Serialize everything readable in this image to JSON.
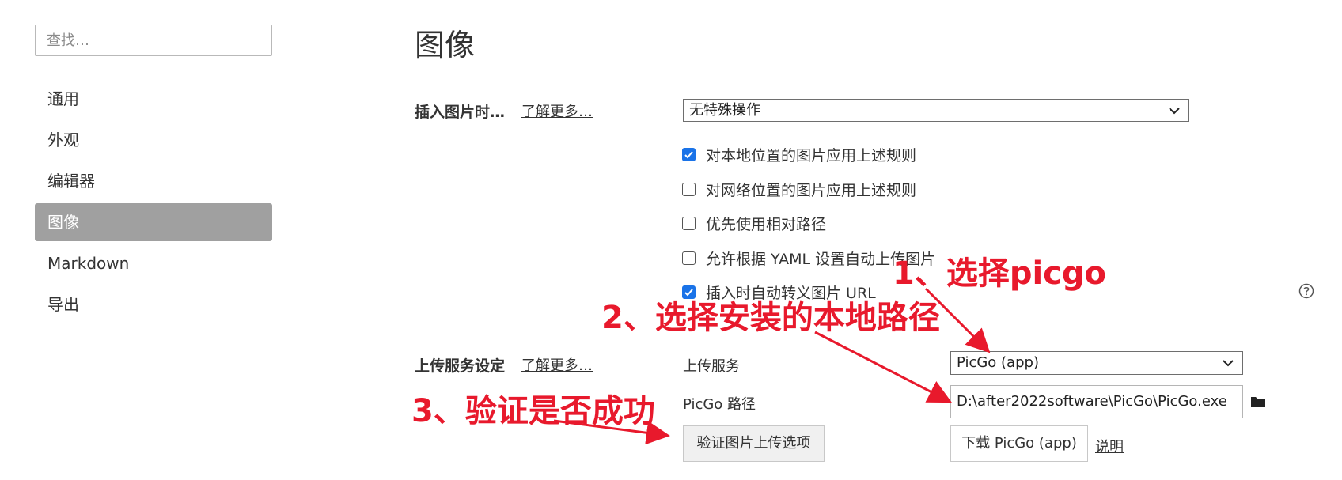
{
  "sidebar": {
    "search_placeholder": "查找…",
    "items": [
      {
        "label": "通用"
      },
      {
        "label": "外观"
      },
      {
        "label": "编辑器"
      },
      {
        "label": "图像",
        "active": true
      },
      {
        "label": "Markdown"
      },
      {
        "label": "导出"
      }
    ]
  },
  "main": {
    "title": "图像",
    "insert_section": {
      "label": "插入图片时…",
      "learn_more": "了解更多…",
      "action_value": "无特殊操作",
      "options": [
        {
          "label": "对本地位置的图片应用上述规则",
          "checked": true
        },
        {
          "label": "对网络位置的图片应用上述规则",
          "checked": false
        },
        {
          "label": "优先使用相对路径",
          "checked": false
        },
        {
          "label": "允许根据 YAML 设置自动上传图片",
          "checked": false
        },
        {
          "label": "插入时自动转义图片 URL",
          "checked": true
        }
      ]
    },
    "upload_section": {
      "label": "上传服务设定",
      "learn_more": "了解更多…",
      "service_label": "上传服务",
      "service_value": "PicGo (app)",
      "path_label": "PicGo 路径",
      "path_value": "D:\\after2022software\\PicGo\\PicGo.exe",
      "verify_button": "验证图片上传选项",
      "download_button": "下载 PicGo (app)",
      "help_link": "说明"
    }
  },
  "annotations": {
    "step1": "1、选择picgo",
    "step2": "2、选择安装的本地路径",
    "step3": "3、验证是否成功",
    "color": "#e8192c"
  },
  "colors": {
    "accent": "#1a73e8",
    "active_nav_bg": "#a0a0a0"
  }
}
